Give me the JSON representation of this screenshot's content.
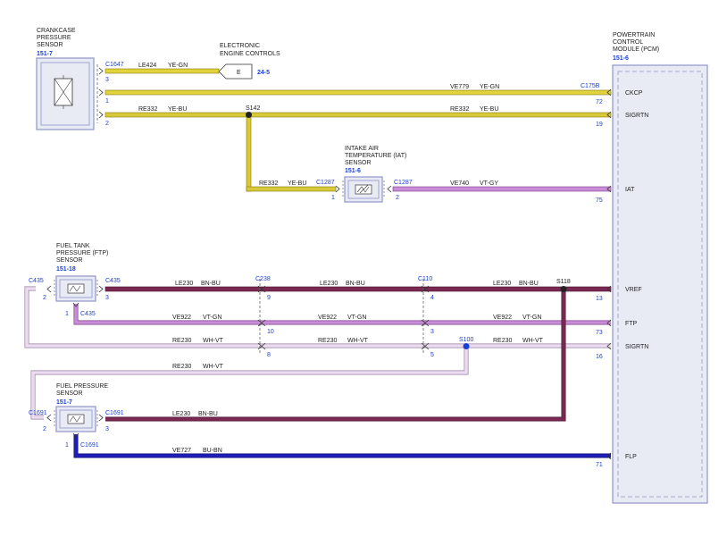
{
  "colors": {
    "ye_gn": "#e0d33c",
    "ye_bu": "#d8c93a",
    "vt_gy": "#c98cd6",
    "bn_bu": "#7a2a52",
    "vt_gn": "#c98cd6",
    "wh_vt": "#ecdcef",
    "bu_bn": "#1f1fb8",
    "box_border": "#8f95c8",
    "box_fill": "#e9ebf4",
    "connector_blue": "#1a3fd6"
  },
  "components": {
    "ckp_sensor": {
      "title_lines": [
        "CRANKCASE",
        "PRESSURE",
        "SENSOR"
      ],
      "ref": "151-7"
    },
    "eec": {
      "title_lines": [
        "ELECTRONIC",
        "ENGINE CONTROLS"
      ],
      "box_letter": "E",
      "ref": "24-5"
    },
    "pcm": {
      "title_lines": [
        "POWERTRAIN",
        "CONTROL",
        "MODULE (PCM)"
      ],
      "ref": "151-6"
    },
    "iat": {
      "title_lines": [
        "INTAKE AIR",
        "TEMPERATURE (IAT)",
        "SENSOR"
      ],
      "ref": "151-6"
    },
    "ftp": {
      "title_lines": [
        "FUEL TANK",
        "PRESSURE (FTP)",
        "SENSOR"
      ],
      "ref": "151-18"
    },
    "fps": {
      "title_lines": [
        "FUEL PRESSURE",
        "SENSOR"
      ],
      "ref": "151-7"
    }
  },
  "connectors": {
    "c1647": "C1647",
    "c175b": "C175B",
    "c1287_left": "C1287",
    "c1287_right": "C1287",
    "c435_left": "C435",
    "c435_right": "C435",
    "c435_bottom": "C435",
    "c238": "C238",
    "c110": "C110",
    "c1691_left": "C1691",
    "c1691_right": "C1691",
    "c1691_bottom": "C1691"
  },
  "splices": {
    "s142": "S142",
    "s118": "S118",
    "s100": "S100"
  },
  "pins": {
    "ckp_3": "3",
    "ckp_1": "1",
    "ckp_2": "2",
    "pcm_72": "72",
    "pcm_19": "19",
    "pcm_75": "75",
    "pcm_13": "13",
    "pcm_73": "73",
    "pcm_16": "16",
    "pcm_71": "71",
    "iat_1": "1",
    "iat_2": "2",
    "ftp_2": "2",
    "ftp_3": "3",
    "ftp_1": "1",
    "c238_9": "9",
    "c238_10": "10",
    "c238_8": "8",
    "c110_4": "4",
    "c110_3": "3",
    "c110_5": "5",
    "fps_2": "2",
    "fps_3": "3",
    "fps_1": "1"
  },
  "pcm_signals": {
    "ckcp": "CKCP",
    "sigrtn_top": "SIGRTN",
    "iat": "IAT",
    "vref": "VREF",
    "ftp": "FTP",
    "sigrtn_bottom": "SIGRTN",
    "flp": "FLP"
  },
  "wires": {
    "w_le424": {
      "circuit": "LE424",
      "color": "YE-GN"
    },
    "w_ve779": {
      "circuit": "VE779",
      "color": "YE-GN"
    },
    "w_re332_a": {
      "circuit": "RE332",
      "color": "YE-BU"
    },
    "w_re332_b": {
      "circuit": "RE332",
      "color": "YE-BU"
    },
    "w_re332_c": {
      "circuit": "RE332",
      "color": "YE-BU"
    },
    "w_ve740": {
      "circuit": "VE740",
      "color": "VT-GY"
    },
    "w_le230_a": {
      "circuit": "LE230",
      "color": "BN-BU"
    },
    "w_le230_b": {
      "circuit": "LE230",
      "color": "BN-BU"
    },
    "w_le230_c": {
      "circuit": "LE230",
      "color": "BN-BU"
    },
    "w_le230_d": {
      "circuit": "LE230",
      "color": "BN-BU"
    },
    "w_ve922_a": {
      "circuit": "VE922",
      "color": "VT-GN"
    },
    "w_ve922_b": {
      "circuit": "VE922",
      "color": "VT-GN"
    },
    "w_ve922_c": {
      "circuit": "VE922",
      "color": "VT-GN"
    },
    "w_re230_a": {
      "circuit": "RE230",
      "color": "WH-VT"
    },
    "w_re230_b": {
      "circuit": "RE230",
      "color": "WH-VT"
    },
    "w_re230_c": {
      "circuit": "RE230",
      "color": "WH-VT"
    },
    "w_re230_d": {
      "circuit": "RE230",
      "color": "WH-VT"
    },
    "w_ve727": {
      "circuit": "VE727",
      "color": "BU-BN"
    }
  }
}
